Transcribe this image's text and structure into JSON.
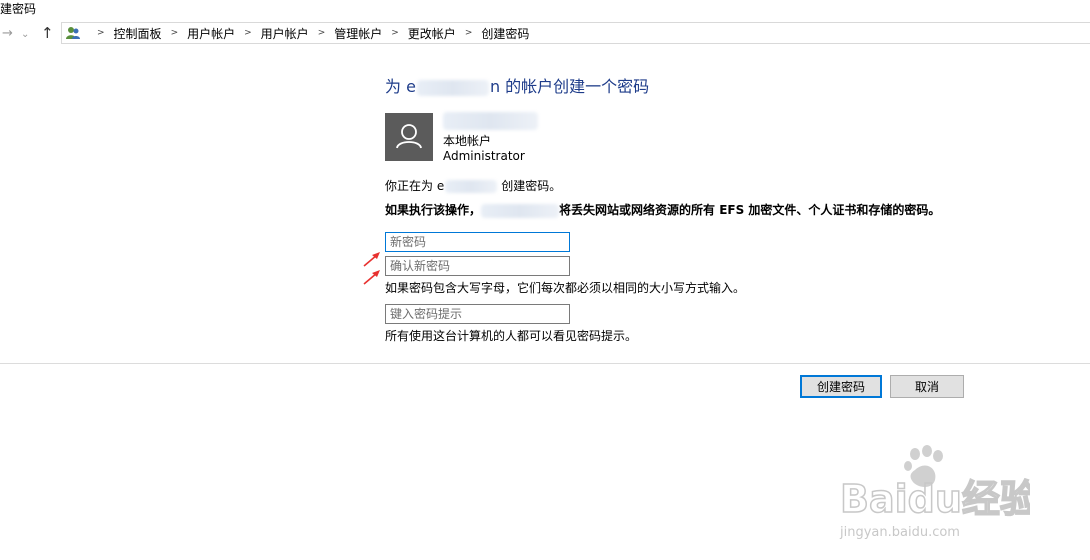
{
  "window": {
    "title": "建密码"
  },
  "nav": {
    "back_icon": "arrow-left-icon",
    "forward_icon": "arrow-right-icon",
    "recent_icon": "chevron-down-icon",
    "up_icon": "arrow-up-icon"
  },
  "breadcrumb": {
    "icon": "users-control-panel-icon",
    "items": [
      "控制面板",
      "用户帐户",
      "用户帐户",
      "管理帐户",
      "更改帐户",
      "创建密码"
    ]
  },
  "main": {
    "heading_prefix": "为 e",
    "heading_suffix": "n 的帐户创建一个密码",
    "account": {
      "avatar_icon": "user-avatar-icon",
      "type": "本地帐户",
      "group": "Administrator"
    },
    "creating_prefix": "你正在为 e",
    "creating_suffix": "创建密码。",
    "warning_prefix": "如果执行该操作，",
    "warning_suffix": "将丢失网站或网络资源的所有 EFS 加密文件、个人证书和存储的密码。",
    "new_password": {
      "placeholder": "新密码",
      "value": ""
    },
    "confirm_password": {
      "placeholder": "确认新密码",
      "value": ""
    },
    "case_note": "如果密码包含大写字母，它们每次都必须以相同的大小写方式输入。",
    "hint": {
      "placeholder": "键入密码提示",
      "value": ""
    },
    "hint_note": "所有使用这台计算机的人都可以看见密码提示。"
  },
  "buttons": {
    "create": "创建密码",
    "cancel": "取消"
  },
  "annotations": {
    "arrow_color": "#e8312f"
  },
  "watermark": {
    "brand": "Baidu经验",
    "url": "jingyan.baidu.com"
  },
  "colors": {
    "accent": "#0078d7",
    "heading": "#1e3c8a"
  }
}
